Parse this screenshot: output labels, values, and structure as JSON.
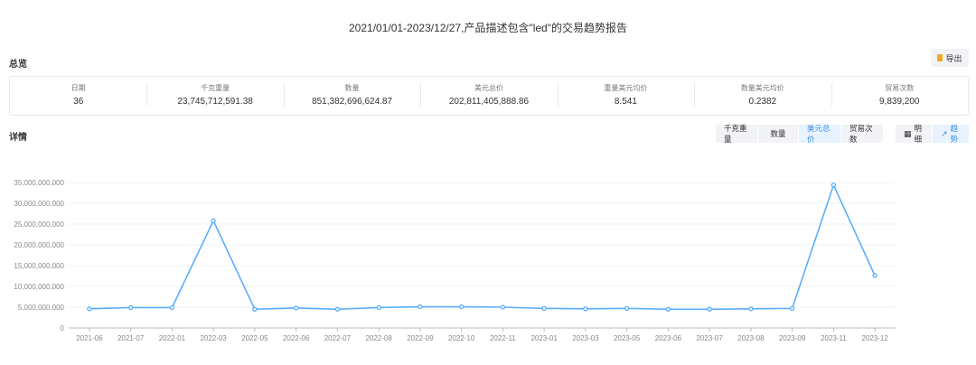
{
  "title": "2021/01/01-2023/12/27,产品描述包含\"led\"的交易趋势报告",
  "overview_label": "总览",
  "export_label": "导出",
  "stats": [
    {
      "label": "日期",
      "value": "36"
    },
    {
      "label": "千克重量",
      "value": "23,745,712,591.38"
    },
    {
      "label": "数量",
      "value": "851,382,696,624.87"
    },
    {
      "label": "美元总价",
      "value": "202,811,405,888.86"
    },
    {
      "label": "重量美元均价",
      "value": "8.541"
    },
    {
      "label": "数量美元均价",
      "value": "0.2382"
    },
    {
      "label": "贸易次数",
      "value": "9,839,200"
    }
  ],
  "detail_label": "详情",
  "metric_tabs": [
    {
      "label": "千克重量",
      "active": false
    },
    {
      "label": "数量",
      "active": false
    },
    {
      "label": "美元总价",
      "active": true
    },
    {
      "label": "贸易次数",
      "active": false
    }
  ],
  "view_tabs": [
    {
      "label": "明细",
      "icon": "table-icon",
      "active": false
    },
    {
      "label": "趋势",
      "icon": "line-chart-icon",
      "active": true
    }
  ],
  "chart_data": {
    "type": "line",
    "color": "#5aaefc",
    "categories": [
      "2021-06",
      "2021-07",
      "2022-01",
      "2022-03",
      "2022-05",
      "2022-06",
      "2022-07",
      "2022-08",
      "2022-09",
      "2022-10",
      "2022-11",
      "2023-01",
      "2023-03",
      "2023-05",
      "2023-06",
      "2023-07",
      "2023-08",
      "2023-09",
      "2023-11",
      "2023-12"
    ],
    "values": [
      4600000000,
      4900000000,
      4900000000,
      25800000000,
      4500000000,
      4800000000,
      4500000000,
      4900000000,
      5100000000,
      5100000000,
      5000000000,
      4700000000,
      4600000000,
      4700000000,
      4500000000,
      4500000000,
      4600000000,
      4700000000,
      34400000000,
      12600000000
    ],
    "yticks": [
      "0",
      "5,000,000,000",
      "10,000,000,000",
      "15,000,000,000",
      "20,000,000,000",
      "25,000,000,000",
      "30,000,000,000",
      "35,000,000,000"
    ],
    "ylim": [
      0,
      35000000000
    ],
    "grid": true
  }
}
